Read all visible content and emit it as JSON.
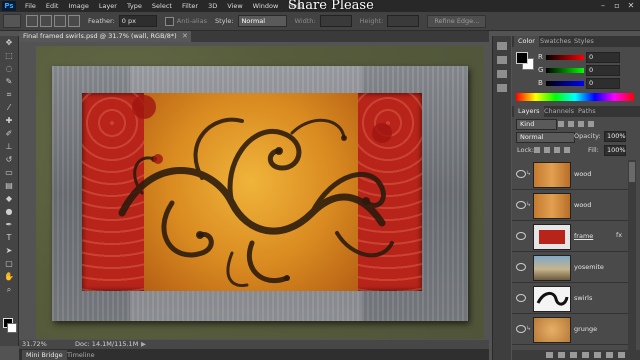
{
  "app": {
    "logo": "Ps",
    "overlay_text": "Share Please"
  },
  "menu": [
    "File",
    "Edit",
    "Image",
    "Layer",
    "Type",
    "Select",
    "Filter",
    "3D",
    "View",
    "Window",
    "Help"
  ],
  "window_controls": [
    "–",
    "▫",
    "✕"
  ],
  "options": {
    "feather_label": "Feather:",
    "feather_value": "0 px",
    "antialias_label": "Anti-alias",
    "style_label": "Style:",
    "style_value": "Normal",
    "width_label": "Width:",
    "height_label": "Height:",
    "refine_button": "Refine Edge..."
  },
  "document": {
    "tab_title": "Final framed swirls.psd @ 31.7% (wall, RGB/8*)",
    "close_glyph": "✕",
    "zoom": "31.72%",
    "doc_info": "Doc: 14.1M/115.1M",
    "info_arrow": "▶"
  },
  "bottom_tabs": [
    "Mini Bridge",
    "Timeline"
  ],
  "color_panel": {
    "tabs": [
      "Color",
      "Swatches",
      "Styles"
    ],
    "rows": [
      {
        "label": "R",
        "value": "0"
      },
      {
        "label": "G",
        "value": "0"
      },
      {
        "label": "B",
        "value": "0"
      }
    ]
  },
  "layers_panel": {
    "tabs": [
      "Layers",
      "Channels",
      "Paths"
    ],
    "filter_value": "Kind",
    "blend_mode": "Normal",
    "opacity_label": "Opacity:",
    "opacity_value": "100%",
    "lock_label": "Lock:",
    "fill_label": "Fill:",
    "fill_value": "100%",
    "layers": [
      {
        "name": "wood",
        "fx": "",
        "selected": false,
        "thumb": "wood"
      },
      {
        "name": "wood",
        "fx": "",
        "selected": false,
        "thumb": "wood"
      },
      {
        "name": "frame",
        "fx": "fx",
        "selected": false,
        "thumb": "frame"
      },
      {
        "name": "yosemite",
        "fx": "",
        "selected": false,
        "thumb": "yosemite"
      },
      {
        "name": "swirls",
        "fx": "",
        "selected": false,
        "thumb": "swirls"
      },
      {
        "name": "grunge",
        "fx": "",
        "selected": false,
        "thumb": "grunge"
      }
    ]
  },
  "colors": {
    "accent_blue": "#31a8ff",
    "art_red": "#b8241a",
    "art_yellow": "#f0b43a",
    "wall_olive": "#5a6040",
    "frame_gray": "#7a7d82"
  }
}
